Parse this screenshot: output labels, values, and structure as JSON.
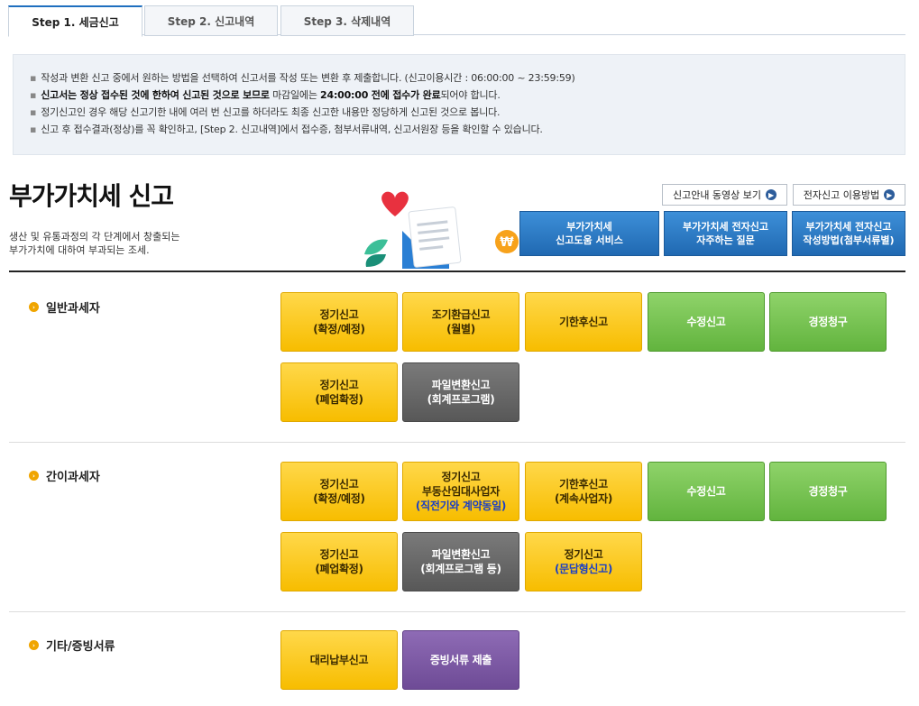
{
  "tabs": [
    "Step 1. 세금신고",
    "Step 2. 신고내역",
    "Step 3. 삭제내역"
  ],
  "info": {
    "line1": "작성과 변환 신고 중에서 원하는 방법을 선택하여 신고서를 작성 또는 변환 후 제출합니다. (신고이용시간 : 06:00:00 ~ 23:59:59)",
    "line2_a": "신고서는 정상 접수된 것에 한하여 신고된 것으로 보므로",
    "line2_b": " 마감일에는 ",
    "line2_c": "24:00:00 전에 접수가 완료",
    "line2_d": "되어야 합니다.",
    "line3": "정기신고인 경우 해당 신고기한 내에 여러 번 신고를 하더라도 최종 신고한 내용만 정당하게 신고된 것으로 봅니다.",
    "line4": "신고 후 접수결과(정상)를 꼭 확인하고, [Step 2. 신고내역]에서 접수증, 첨부서류내역, 신고서원장 등을 확인할 수 있습니다."
  },
  "title": "부가가치세 신고",
  "description": [
    "생산 및 유통과정의 각 단계에서 창출되는",
    "부가가치에 대하여 부과되는 조세."
  ],
  "links": [
    "신고안내 동영상 보기",
    "전자신고 이용방법"
  ],
  "help_buttons": [
    [
      "부가가치세",
      "신고도움 서비스"
    ],
    [
      "부가가치세 전자신고",
      "자주하는 질문"
    ],
    [
      "부가가치세 전자신고",
      "작성방법(첨부서류별)"
    ]
  ],
  "sections": {
    "general": {
      "label": "일반과세자",
      "buttons": [
        [
          "정기신고",
          "(확정/예정)"
        ],
        [
          "조기환급신고",
          "(월별)"
        ],
        [
          "기한후신고"
        ],
        [
          "수정신고"
        ],
        [
          "경정청구"
        ],
        [
          "정기신고",
          "(폐업확정)"
        ],
        [
          "파일변환신고",
          "(회계프로그램)"
        ]
      ]
    },
    "simple": {
      "label": "간이과세자",
      "buttons": [
        [
          "정기신고",
          "(확정/예정)"
        ],
        [
          "정기신고",
          "부동산임대사업자",
          "(직전기와 계약동일)"
        ],
        [
          "기한후신고",
          "(계속사업자)"
        ],
        [
          "수정신고"
        ],
        [
          "경정청구"
        ],
        [
          "정기신고",
          "(폐업확정)"
        ],
        [
          "파일변환신고",
          "(회계프로그램 등)"
        ],
        [
          "정기신고",
          "(문답형신고)"
        ]
      ]
    },
    "other": {
      "label": "기타/증빙서류",
      "buttons": [
        [
          "대리납부신고"
        ],
        [
          "증빙서류 제출"
        ]
      ]
    }
  },
  "colors": {
    "yellow": "#f7bd00",
    "green": "#62b43e",
    "gray": "#585858",
    "purple": "#6e4b96",
    "blue": "#2069b2",
    "highlight_text": "#1b3fc4"
  }
}
